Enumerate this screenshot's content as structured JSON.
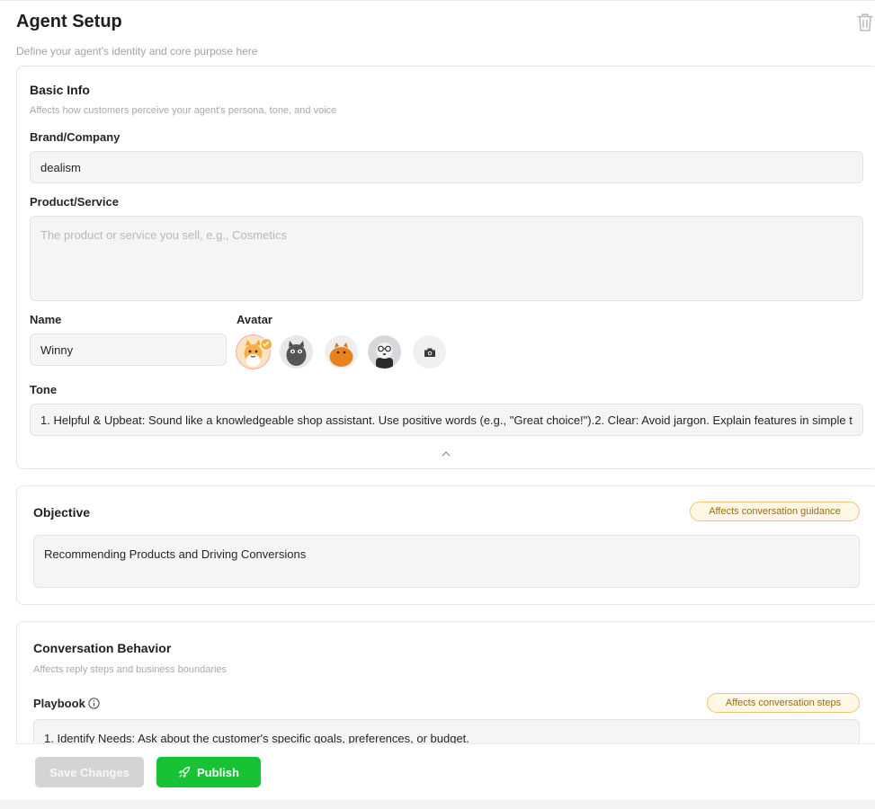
{
  "header": {
    "title": "Agent Setup",
    "subtitle": "Define your agent's identity and core purpose here",
    "delete_icon": "trash-icon"
  },
  "basic_info": {
    "title": "Basic Info",
    "subtitle": "Affects how customers perceive your agent's persona, tone, and voice",
    "brand_label": "Brand/Company",
    "brand_value": "dealism",
    "product_label": "Product/Service",
    "product_placeholder": "The product or service you sell, e.g., Cosmetics",
    "product_value": "",
    "name_label": "Name",
    "name_value": "Winny",
    "avatar_label": "Avatar",
    "avatars": [
      {
        "icon": "avatar-orange-cat-icon",
        "selected": true
      },
      {
        "icon": "avatar-grey-cat-icon",
        "selected": false
      },
      {
        "icon": "avatar-orange-round-icon",
        "selected": false
      },
      {
        "icon": "avatar-glasses-icon",
        "selected": false
      }
    ],
    "upload_icon": "camera-icon",
    "tone_label": "Tone",
    "tone_value": "1. Helpful & Upbeat: Sound like a knowledgeable shop assistant. Use positive words (e.g., \"Great choice!\").2. Clear: Avoid jargon. Explain features in simple t",
    "collapse_icon": "chevron-up-icon"
  },
  "objective": {
    "title": "Objective",
    "badge": "Affects conversation guidance",
    "value": "Recommending Products and Driving Conversions"
  },
  "conversation_behavior": {
    "title": "Conversation Behavior",
    "subtitle": "Affects reply steps and business boundaries",
    "playbook_label": "Playbook",
    "playbook_badge": "Affects conversation steps",
    "playbook_value": "1. Identify Needs: Ask about the customer's specific goals, preferences, or budget."
  },
  "footer": {
    "save_label": "Save Changes",
    "publish_label": "Publish",
    "publish_icon": "rocket-icon"
  },
  "colors": {
    "primary_green": "#17c334",
    "badge_border": "#f2c66c",
    "badge_text": "#a06b0b",
    "disabled_button": "#d4d4d4"
  }
}
